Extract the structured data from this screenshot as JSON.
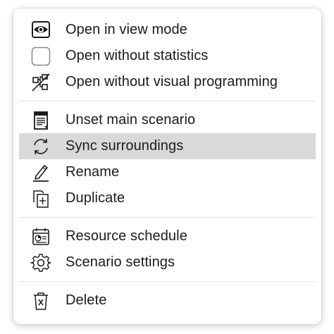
{
  "menu": {
    "groups": [
      {
        "items": [
          {
            "label": "Open in view mode",
            "icon": "eye-icon"
          },
          {
            "label": "Open without statistics",
            "icon": "checkbox-icon"
          },
          {
            "label": "Open without visual programming",
            "icon": "visual-programming-off-icon"
          }
        ]
      },
      {
        "items": [
          {
            "label": "Unset main scenario",
            "icon": "document-icon"
          },
          {
            "label": "Sync surroundings",
            "icon": "sync-icon",
            "highlighted": true
          },
          {
            "label": "Rename",
            "icon": "pencil-icon"
          },
          {
            "label": "Duplicate",
            "icon": "duplicate-icon"
          }
        ]
      },
      {
        "items": [
          {
            "label": "Resource schedule",
            "icon": "calendar-icon"
          },
          {
            "label": "Scenario settings",
            "icon": "gear-icon"
          }
        ]
      },
      {
        "items": [
          {
            "label": "Delete",
            "icon": "trash-icon"
          }
        ]
      }
    ],
    "highlight_color": "#d9d9d9"
  }
}
